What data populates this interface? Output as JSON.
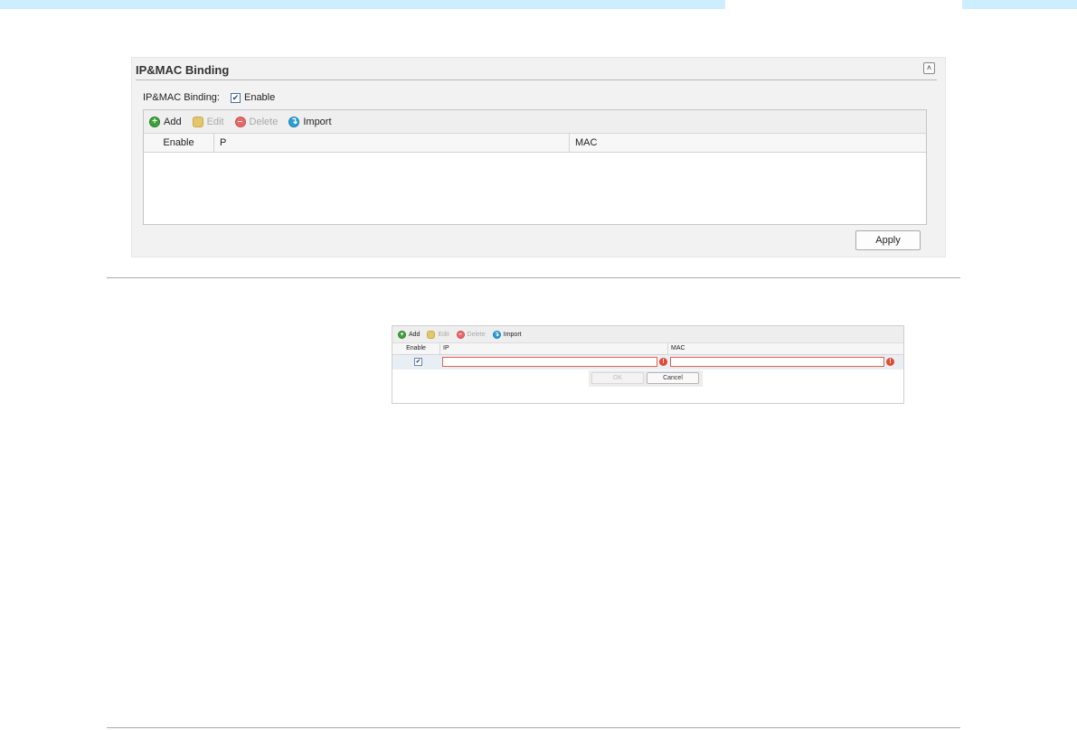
{
  "panel": {
    "title": "IP&MAC Binding",
    "binding_label": "IP&MAC Binding:",
    "enable_label": "Enable",
    "enable_checked": true,
    "toolbar": {
      "add": "Add",
      "edit": "Edit",
      "delete": "Delete",
      "import": "Import"
    },
    "columns": [
      "Enable",
      "P",
      "MAC"
    ],
    "apply_label": "Apply"
  },
  "mini_grid": {
    "toolbar": {
      "add": "Add",
      "edit": "Edit",
      "delete": "Delete",
      "import": "Import"
    },
    "columns": [
      "Enable",
      "IP",
      "MAC"
    ],
    "row": {
      "enable_checked": true,
      "ip_value": "",
      "mac_value": ""
    },
    "ok_label": "OK",
    "cancel_label": "Cancel"
  },
  "colors": {
    "banner": "#cdeefe",
    "error": "#e2492f",
    "add_icon": "#3aa43a",
    "import_icon": "#2a9fd8",
    "delete_icon": "#e76a6a"
  },
  "icons": [
    "collapse-icon",
    "add-icon",
    "edit-icon",
    "delete-icon",
    "import-icon",
    "error-icon",
    "checkbox-icon"
  ]
}
